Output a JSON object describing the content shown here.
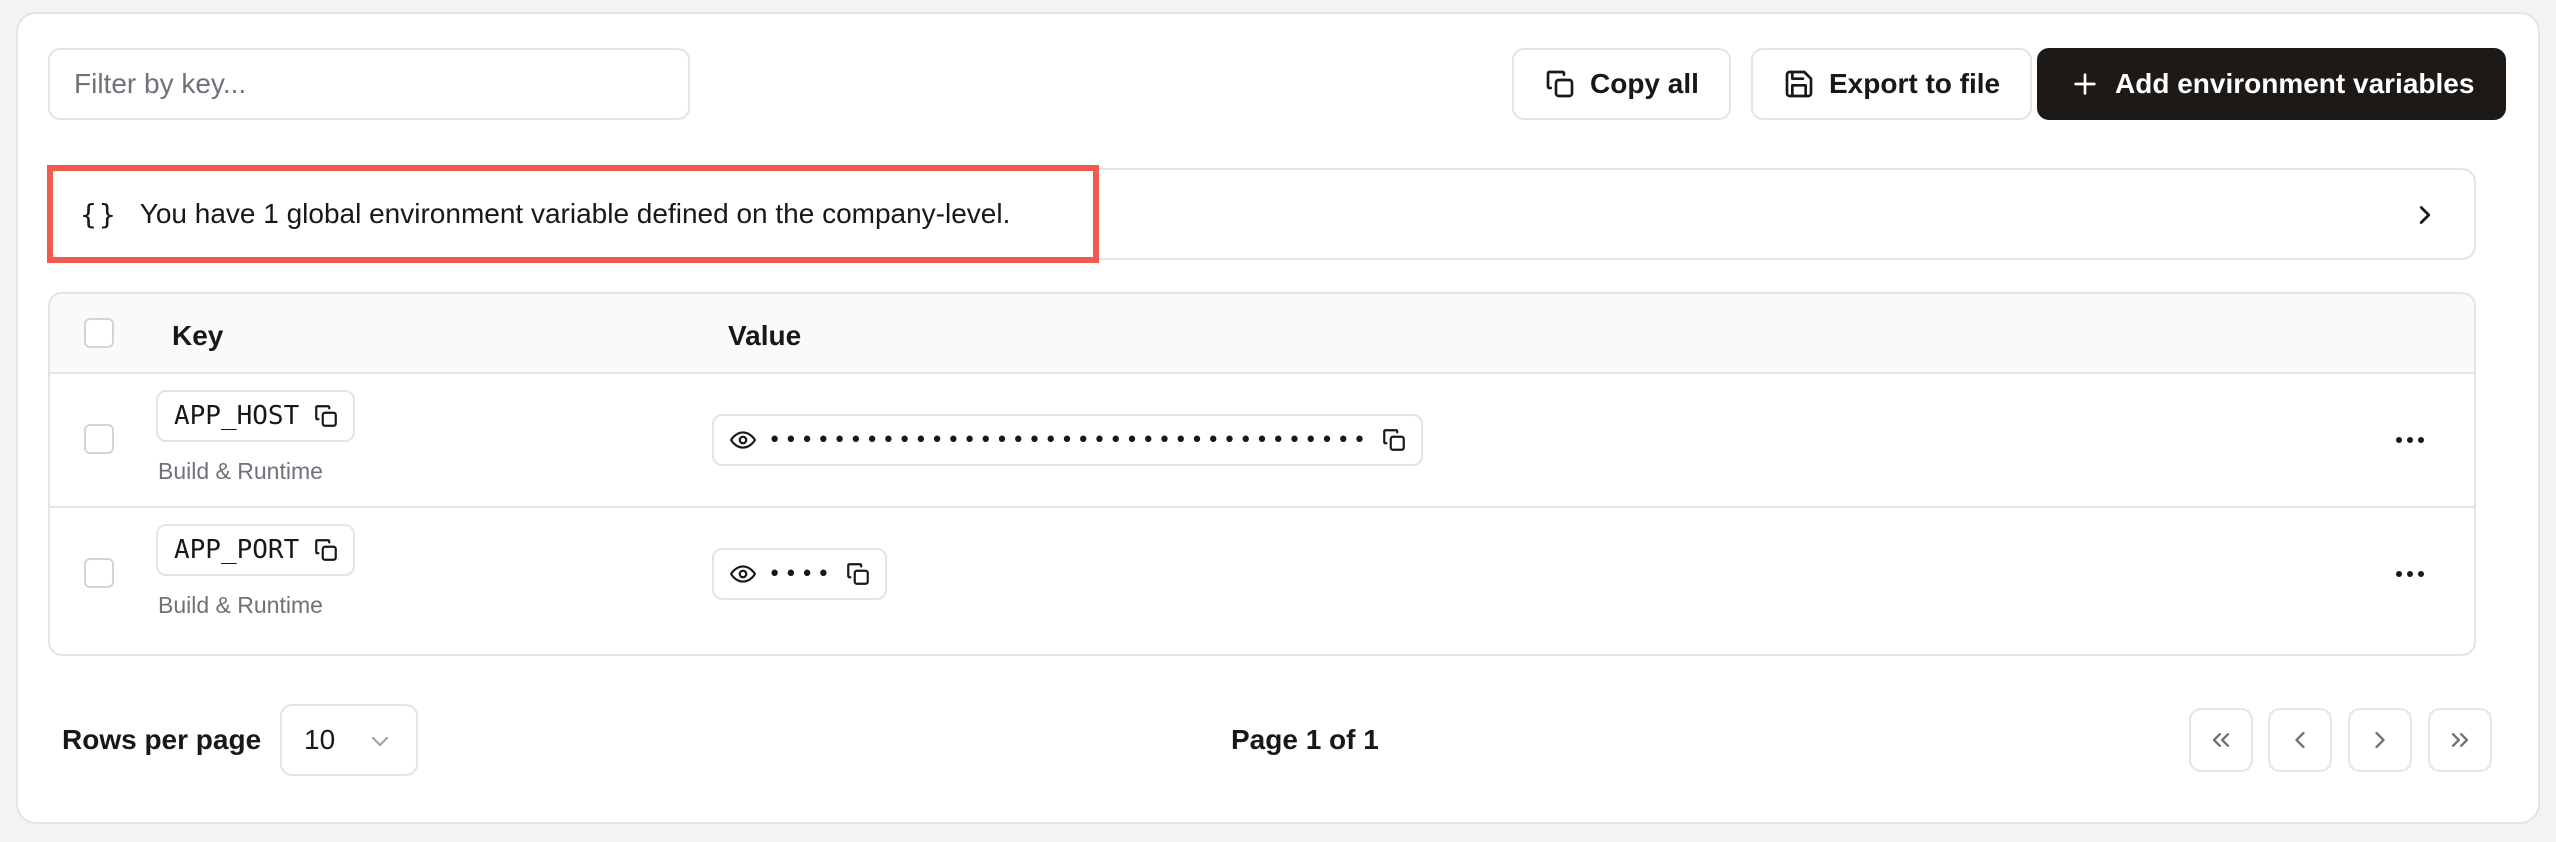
{
  "toolbar": {
    "filter_placeholder": "Filter by key...",
    "copy_all_label": "Copy all",
    "export_label": "Export to file",
    "add_label": "Add environment variables"
  },
  "banner": {
    "braces": "{}",
    "text": "You have 1 global environment variable defined on the company-level."
  },
  "table": {
    "headers": {
      "key": "Key",
      "value": "Value"
    },
    "rows": [
      {
        "key": "APP_HOST",
        "scope": "Build & Runtime",
        "masked_value": "•••••••••••••••••••••••••••••••••••••"
      },
      {
        "key": "APP_PORT",
        "scope": "Build & Runtime",
        "masked_value": "••••"
      }
    ]
  },
  "pagination": {
    "rows_per_page_label": "Rows per page",
    "rows_per_page_value": "10",
    "page_info": "Page 1 of 1"
  },
  "colors": {
    "primary_button_bg": "#1c1917",
    "highlight_border": "#f05a4f",
    "border": "#e4e4e7",
    "muted_text": "#71717a"
  },
  "icons": {
    "copy": "copy-icon",
    "save": "save-icon",
    "plus": "plus-icon",
    "eye": "eye-icon",
    "chevron_right": "chevron-right-icon",
    "more": "more-horizontal-icon"
  }
}
